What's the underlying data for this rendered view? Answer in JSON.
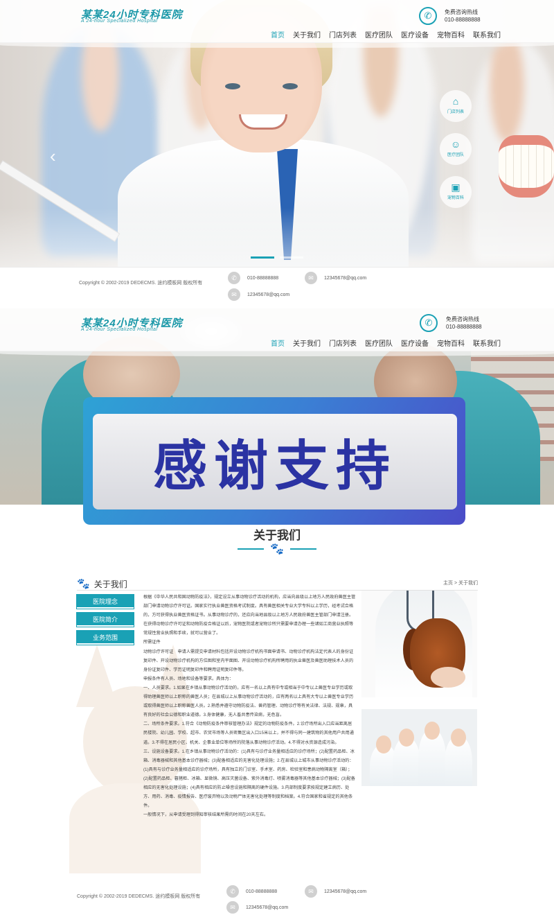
{
  "header": {
    "logo_title": "某某24小时专科医院",
    "logo_subtitle": "A 24-hour Specialized Hospital",
    "hotline_label": "免费咨询热线",
    "hotline_number": "010-88888888",
    "nav": [
      "首页",
      "关于我们",
      "门店列表",
      "医疗团队",
      "医疗设备",
      "宠物百科",
      "联系我们"
    ]
  },
  "side_nav": [
    {
      "icon": "home-icon",
      "label": "门店列表"
    },
    {
      "icon": "team-icon",
      "label": "医疗团队"
    },
    {
      "icon": "encyclopedia-icon",
      "label": "宠物百科"
    }
  ],
  "footer": {
    "copyright": "Copyright © 2002-2019 DEDECMS. 途约模板网 版权所有",
    "phone": "010-88888888",
    "qq": "12345678@qq.com",
    "email": "12345678@qq.com"
  },
  "thanks_banner": "感谢支持",
  "section_title": "关于我们",
  "about": {
    "heading": "关于我们",
    "breadcrumb": "主页 > 关于我们",
    "menu": [
      "医院理念",
      "医院简介",
      "业务范围"
    ],
    "paragraphs": [
      "根据《中华人民共和国动物防疫法》，规定设立从事动物诊疗活动的机构，应当向县级以上地方人民政府兽医主管部门申请动物诊疗许可证。国家实行执业兽医资格考试制度。具有兽医相关专业大学专科以上学历，经考试合格的，方可获得执业兽医资格证书。从事动物诊疗的，还应向当地县级以上地方人民政府兽医主管部门申请注册。",
      "在获得动物诊疗许可证和动物防疫合格证以后，宠物医院或者宠物诊所只需要申请办理一些诸如工商营业执照等常规性营业执照和手续，就可以营业了。",
      "所需证件",
      "动物诊疗许可证　申请人需提交申请材料包括开设动物诊疗机构书面申请书、动物诊疗机构法定代表人的身份证复印件、开设动物诊疗机构的方位图和室内平面图、开设动物诊疗机构所聘用的执业兽医及兽医助理技术人员的身份证复印件、学历证明复印件和聘用证明复印件等。",
      "申报条件有人员、场地和设备等要求。具体为：",
      "一、人员要求。1.如果在乡镇从事动物诊疗活动的，应有一名以上具有中专或相当于中专以上兽医专业学历或取得助理兽医师以上职称的兽医人员；在县城以上从事动物诊疗活动的，应有两名以上具有大专以上兽医专业学历或取得兽医师以上职称兽医人员。2.熟悉并遵守动物防疫法、兽药管理、动物诊疗等有关法律、法规、规章，具有良好的社会公德和职业道德。3.身体健康，无人畜共患传染病，无色盲。",
      "二、场所条件要求。1.符合《动物防疫条件审核管理办法》规定的动物防疫条件。2.诊疗场所出入口应当距离居民楼院、幼儿园、学校、超市、农贸市场等人员密集区出入口15米以上，并不得与同一建筑物的其他用户共用通道。3.不得在居民小区、机关、企事业单位等场所的院落从事动物诊疗活动。4.不得对水资源造成污染。",
      "三、设施设备要求。1.在乡镇从事动物诊疗活动的：(1)具有与诊疗业务量相适应的诊疗场所；(2)配置药品柜、冰箱、消毒器械和其他基本诊疗器械；(3)配备相适应的无害化处理设施；2.在县城以上城市从事动物诊疗活动的：(1)具有与诊疗业务量相适应的诊疗场所，具有独立的门诊室、手术室、药房、检验室和患病动物隔离室（箱）；(2)配置药品柜、暮猪柜、冰箱、显微镜、高压灭菌设备、紫外消毒灯、喷雾消毒器等其他基本诊疗器械；(3)配备相应的无害化处理设施；(4)具有相应的防止噪音设施和隔离的硬件设施。3.内部制度要求按规定建立病历、处方、用药、消毒、疫情报告、医疗废弃物以及动物尸体无害化处理等制度和档案。4.符合国家和省规定的其他条件。",
      "一般情况下，从申请受理到得知审核结果所需的时间在20天左右。"
    ]
  },
  "colors": {
    "accent": "#1aa1b5",
    "banner_start": "#2ea2d5",
    "banner_end": "#4b4cc8",
    "banner_text": "#2b33a3"
  }
}
